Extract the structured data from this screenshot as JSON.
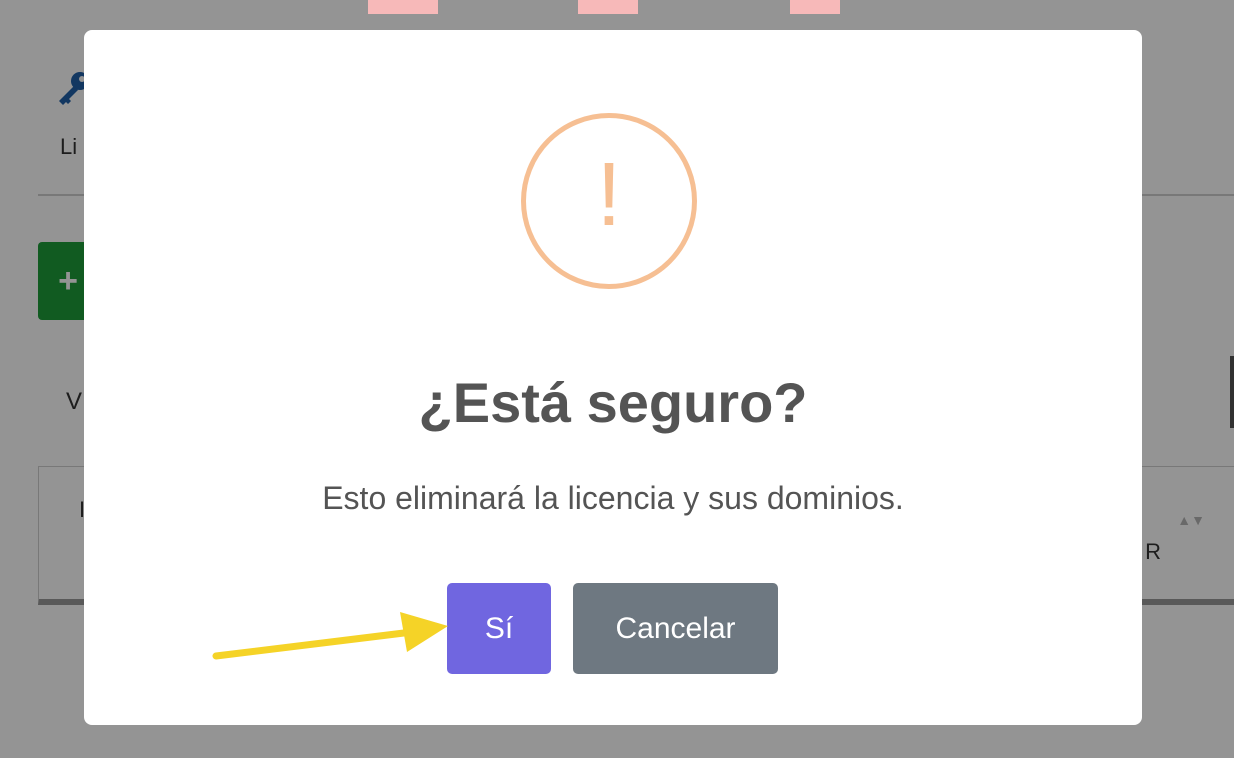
{
  "background_page": {
    "title_partial": "Li",
    "add_button_label": "+",
    "view_label_partial": "V",
    "table_header_start_partial": "I",
    "table_header_end_partial": "R",
    "sort_arrows": "▲▼"
  },
  "dialog": {
    "icon": "warning-exclamation-icon",
    "icon_glyph": "!",
    "icon_color": "#f6bf93",
    "title": "¿Está seguro?",
    "message": "Esto eliminará la licencia y sus dominios.",
    "confirm_label": "Sí",
    "cancel_label": "Cancelar",
    "confirm_color": "#7066e0",
    "cancel_color": "#6e7881"
  },
  "annotation": {
    "arrow_color": "#f5d327",
    "points_to": "confirm-button"
  }
}
